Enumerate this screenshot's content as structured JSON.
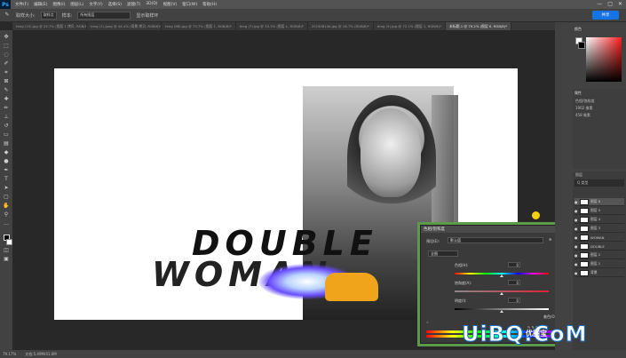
{
  "menubar": {
    "logo": "Ps",
    "items": [
      "文件(F)",
      "编辑(E)",
      "图像(I)",
      "图层(L)",
      "文字(Y)",
      "选择(S)",
      "滤镜(T)",
      "3D(D)",
      "视图(V)",
      "窗口(W)",
      "帮助(H)"
    ],
    "controls": [
      "—",
      "□",
      "✕"
    ]
  },
  "options": {
    "sample_size_label": "取样大小:",
    "sample_size_value": "取样点",
    "sample_label": "样本:",
    "sample_value": "所有图层",
    "show_ring": "显示取样环",
    "share_label": "共享"
  },
  "tabs": [
    {
      "label": "timg (10).jpg @ 22.7% (图层 1 拷贝, RGB/8)*",
      "active": false
    },
    {
      "label": "timg (1).jpeg @ 44.4% (背景 拷贝, RGB/8)*",
      "active": false
    },
    {
      "label": "timg (88).jpg @ 73.7% (图层 1, RGB/8)*",
      "active": false
    },
    {
      "label": "timg (7).jpg @ 33.3% (图层 1, RGB/8)*",
      "active": false
    },
    {
      "label": "20190814b.jpg @ 16.7% (RGB/8)*",
      "active": false
    },
    {
      "label": "timg (5).jpg @ 72.1% (图层 1, RGB/8)*",
      "active": false
    },
    {
      "label": "未标题-1 @ 79.2% (图层 6, RGB/8)*",
      "active": true
    }
  ],
  "artwork": {
    "word1": "DOUBLE",
    "word2": "WOMAN"
  },
  "dialog": {
    "title": "色相/饱和度",
    "preset_label": "预设(E):",
    "preset_value": "默认值",
    "channel_value": "全图",
    "ok_label": "确定",
    "cancel_label": "取消",
    "hue_label": "色相(H):",
    "hue_value": "0",
    "sat_label": "饱和度(A):",
    "sat_value": "0",
    "light_label": "明度(I):",
    "light_value": "0",
    "colorize_label": "着色(O)",
    "preview_label": "预览(P)"
  },
  "panels": {
    "color_title": "颜色",
    "props_title": "属性",
    "props_subtitle": "色相/饱和度",
    "props_rows": [
      "1902 像素",
      "458 像素"
    ],
    "layers_title": "图层",
    "layers_kind": "Q 类型",
    "layers": [
      {
        "name": "图层 6",
        "selected": true
      },
      {
        "name": "图层 5",
        "selected": false
      },
      {
        "name": "图层 4",
        "selected": false
      },
      {
        "name": "图层 3",
        "selected": false
      },
      {
        "name": "WOMAN",
        "selected": false
      },
      {
        "name": "DOUBLE",
        "selected": false
      },
      {
        "name": "图层 2",
        "selected": false
      },
      {
        "name": "图层 1",
        "selected": false
      },
      {
        "name": "背景",
        "selected": false
      }
    ]
  },
  "status": {
    "zoom": "79.17%",
    "doc": "文档:5.49M/41.0M"
  },
  "watermark": {
    "text": "UiBQ.CoM",
    "sub": "优图宝"
  },
  "colors": {
    "dialog_border": "#5c9a4e",
    "share": "#1473e6",
    "taxi": "#f0a41b"
  }
}
